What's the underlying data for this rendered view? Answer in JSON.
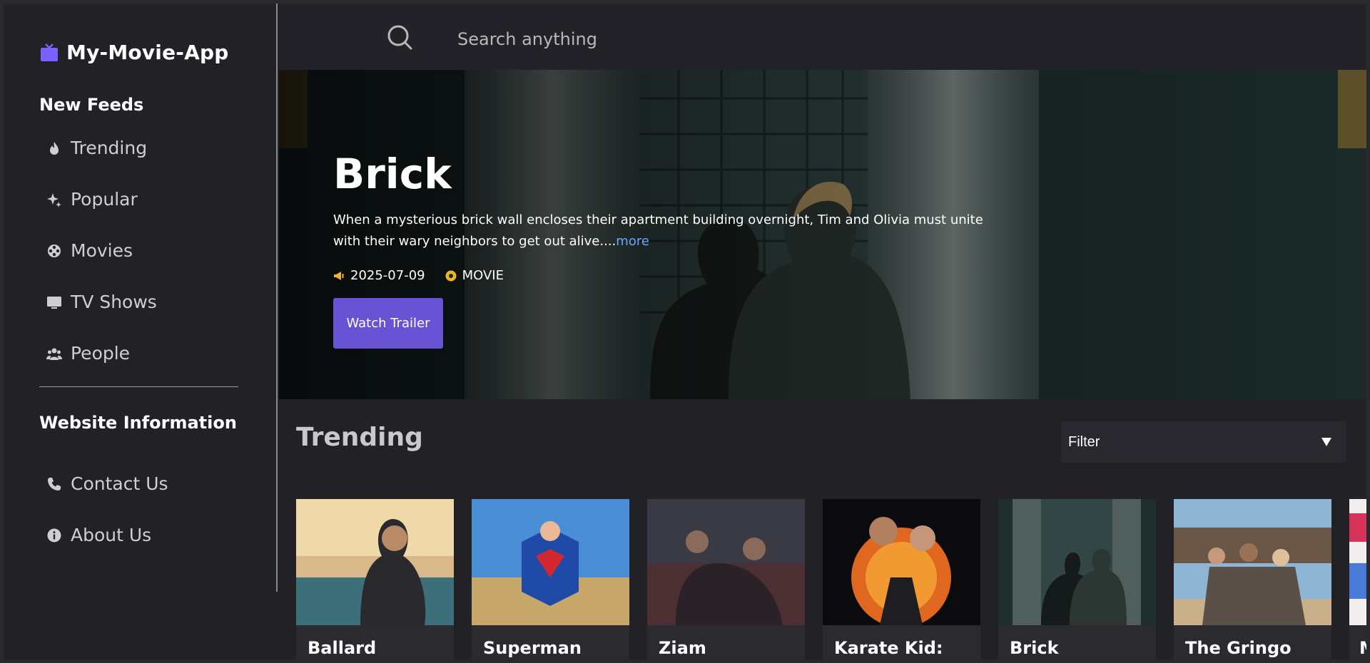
{
  "app": {
    "name": "My-Movie-App",
    "accent": "#6753d4"
  },
  "sidebar": {
    "section_feeds": "New Feeds",
    "feeds": [
      {
        "label": "Trending",
        "icon": "fire-icon"
      },
      {
        "label": "Popular",
        "icon": "sparkle-icon"
      },
      {
        "label": "Movies",
        "icon": "film-reel-icon"
      },
      {
        "label": "TV Shows",
        "icon": "tv-icon"
      },
      {
        "label": "People",
        "icon": "people-icon"
      }
    ],
    "section_info": "Website Information",
    "info": [
      {
        "label": "Contact Us",
        "icon": "phone-icon"
      },
      {
        "label": "About Us",
        "icon": "info-icon"
      }
    ]
  },
  "search": {
    "placeholder": "Search anything"
  },
  "hero": {
    "title": "Brick",
    "description": "When a mysterious brick wall encloses their apartment building overnight, Tim and Olivia must unite with their wary neighbors to get out alive....",
    "more_label": "more",
    "date": "2025-07-09",
    "media_type": "MOVIE",
    "button_label": "Watch Trailer"
  },
  "trending": {
    "title": "Trending",
    "filter_label": "Filter",
    "filter_icon": "triangle-down-icon",
    "items": [
      {
        "title": "Ballard"
      },
      {
        "title": "Superman"
      },
      {
        "title": "Ziam"
      },
      {
        "title": "Karate Kid:"
      },
      {
        "title": "Brick"
      },
      {
        "title": "The Gringo"
      },
      {
        "title": "M"
      }
    ]
  }
}
